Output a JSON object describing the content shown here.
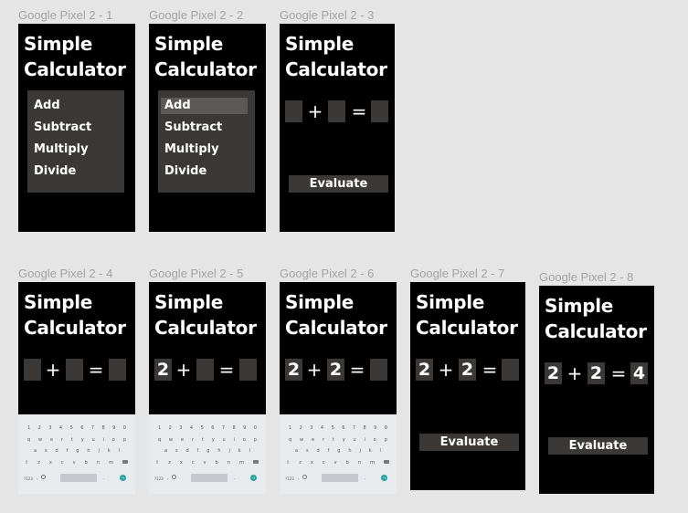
{
  "app": {
    "title_line1": "Simple",
    "title_line2": "Calculator"
  },
  "menu_items": [
    "Add",
    "Subtract",
    "Multiply",
    "Divide"
  ],
  "evaluate_label": "Evaluate",
  "frames": [
    {
      "label": "Google Pixel 2 - 1",
      "screen": "menu",
      "highlight": null
    },
    {
      "label": "Google Pixel 2 - 2",
      "screen": "menu",
      "highlight": "Add"
    },
    {
      "label": "Google Pixel 2 - 3",
      "screen": "equation",
      "operand1": "",
      "operator": "+",
      "operand2": "",
      "equals": "=",
      "result": "",
      "evaluate_button": true,
      "keyboard": false
    },
    {
      "label": "Google Pixel 2 - 4",
      "screen": "equation",
      "operand1": "",
      "operator": "+",
      "operand2": "",
      "equals": "=",
      "result": "",
      "evaluate_button": false,
      "keyboard": true
    },
    {
      "label": "Google Pixel 2 - 5",
      "screen": "equation",
      "operand1": "2",
      "operator": "+",
      "operand2": "",
      "equals": "=",
      "result": "",
      "evaluate_button": false,
      "keyboard": true
    },
    {
      "label": "Google Pixel 2 - 6",
      "screen": "equation",
      "operand1": "2",
      "operator": "+",
      "operand2": "2",
      "equals": "=",
      "result": "",
      "evaluate_button": false,
      "keyboard": true
    },
    {
      "label": "Google Pixel 2 - 7",
      "screen": "equation",
      "operand1": "2",
      "operator": "+",
      "operand2": "2",
      "equals": "=",
      "result": "",
      "evaluate_button": true,
      "keyboard": false
    },
    {
      "label": "Google Pixel 2 - 8",
      "screen": "equation",
      "operand1": "2",
      "operator": "+",
      "operand2": "2",
      "equals": "=",
      "result": "4",
      "evaluate_button": true,
      "keyboard": false
    }
  ],
  "keyboard": {
    "row1": [
      "1",
      "2",
      "3",
      "4",
      "5",
      "6",
      "7",
      "8",
      "9",
      "0"
    ],
    "row2": [
      "q",
      "w",
      "e",
      "r",
      "t",
      "y",
      "u",
      "i",
      "o",
      "p"
    ],
    "row3": [
      "a",
      "s",
      "d",
      "f",
      "g",
      "h",
      "j",
      "k",
      "l"
    ],
    "row4": [
      "z",
      "x",
      "c",
      "v",
      "b",
      "n",
      "m"
    ],
    "shift_glyph": "⇧",
    "num_key": "?123",
    "comma_key": ",",
    "period_key": ".",
    "enter_glyph": "→"
  },
  "colors": {
    "canvas_bg": "#e5e5e5",
    "screen_bg": "#000000",
    "control_bg": "#3b3835",
    "highlight_bg": "#5b5855",
    "keyboard_bg": "#e8ebee",
    "enter_key": "#27a4a1",
    "label_text": "#a3a3a3"
  }
}
